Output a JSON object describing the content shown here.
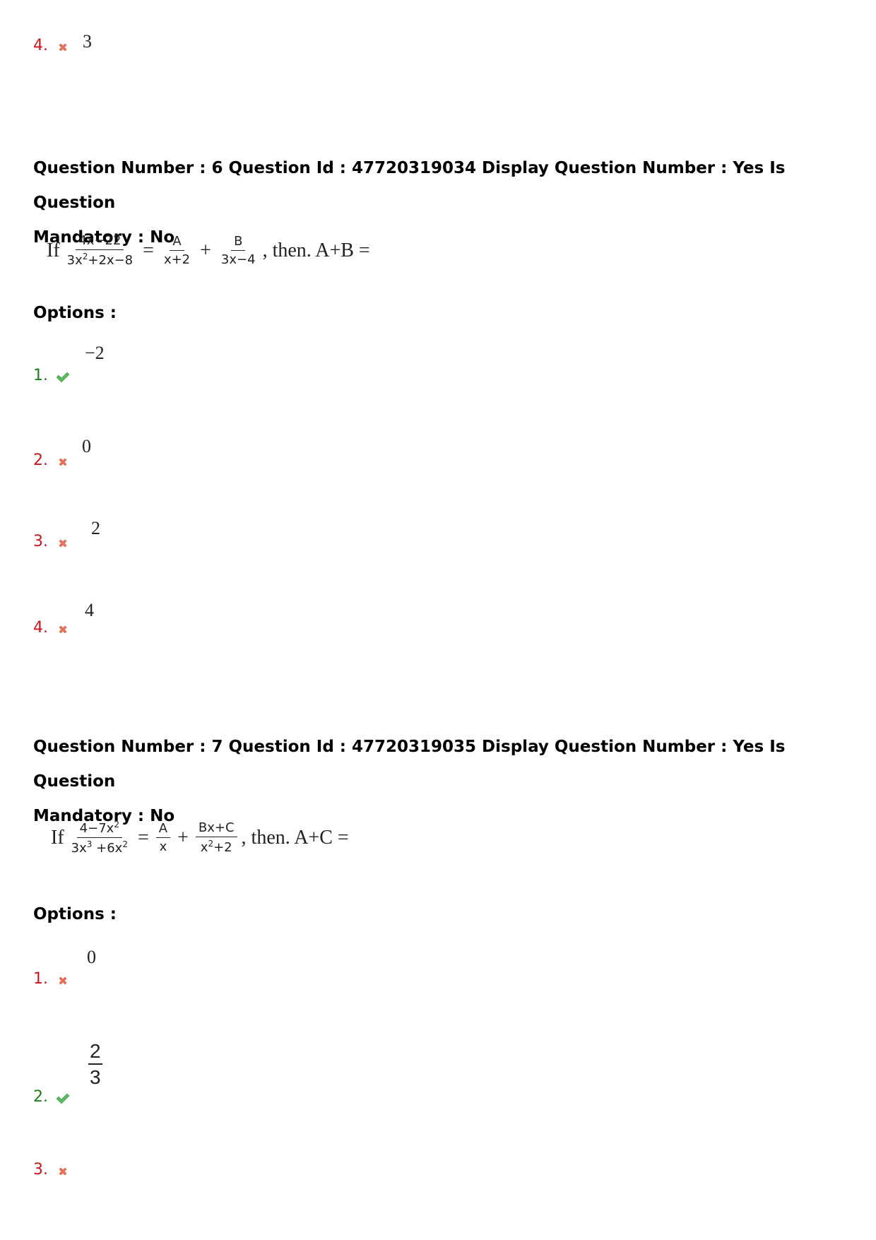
{
  "prev_question_tail": {
    "option": {
      "index": "4.",
      "correct": false,
      "value": "3"
    }
  },
  "questions": [
    {
      "header_line1": "Question Number : 6 Question Id : 47720319034 Display Question Number : Yes Is Question",
      "header_line2": "Mandatory : No",
      "stem": {
        "prefix": "If",
        "lhs_num": "4x−22",
        "lhs_den_base": "3x",
        "lhs_den_exp": "2",
        "lhs_den_rest": "+2x−8",
        "eq": "=",
        "t1_num": "A",
        "t1_den": "x+2",
        "plus": "+",
        "t2_num": "B",
        "t2_den": "3x−4",
        "suffix": ", then. A+B ="
      },
      "options_label": "Options :",
      "options": [
        {
          "index": "1.",
          "correct": true,
          "value": "−2"
        },
        {
          "index": "2.",
          "correct": false,
          "value": "0"
        },
        {
          "index": "3.",
          "correct": false,
          "value": "2"
        },
        {
          "index": "4.",
          "correct": false,
          "value": "4"
        }
      ]
    },
    {
      "header_line1": "Question Number : 7 Question Id : 47720319035 Display Question Number : Yes Is Question",
      "header_line2": "Mandatory : No",
      "stem": {
        "prefix": "If",
        "lhs_num_a": "4−7x",
        "lhs_num_exp": "2",
        "lhs_den_a": "3x",
        "lhs_den_exp1": "3",
        "lhs_den_b": " +6x",
        "lhs_den_exp2": "2",
        "eq": "=",
        "t1_num": "A",
        "t1_den": "x",
        "plus": "+",
        "t2_num": "Bx+C",
        "t2_den_a": "x",
        "t2_den_exp": "2",
        "t2_den_b": "+2",
        "suffix": ", then. A+C ="
      },
      "options_label": "Options :",
      "options": [
        {
          "index": "1.",
          "correct": false,
          "value": "0"
        },
        {
          "index": "2.",
          "correct": true,
          "value_num": "2",
          "value_den": "3"
        },
        {
          "index": "3.",
          "correct": false,
          "value": ""
        }
      ]
    }
  ],
  "colors": {
    "wrong": "#c8161d",
    "correct": "#1e7d1e",
    "cross_icon": "#e8735a",
    "check_icon": "#5cb85c"
  }
}
